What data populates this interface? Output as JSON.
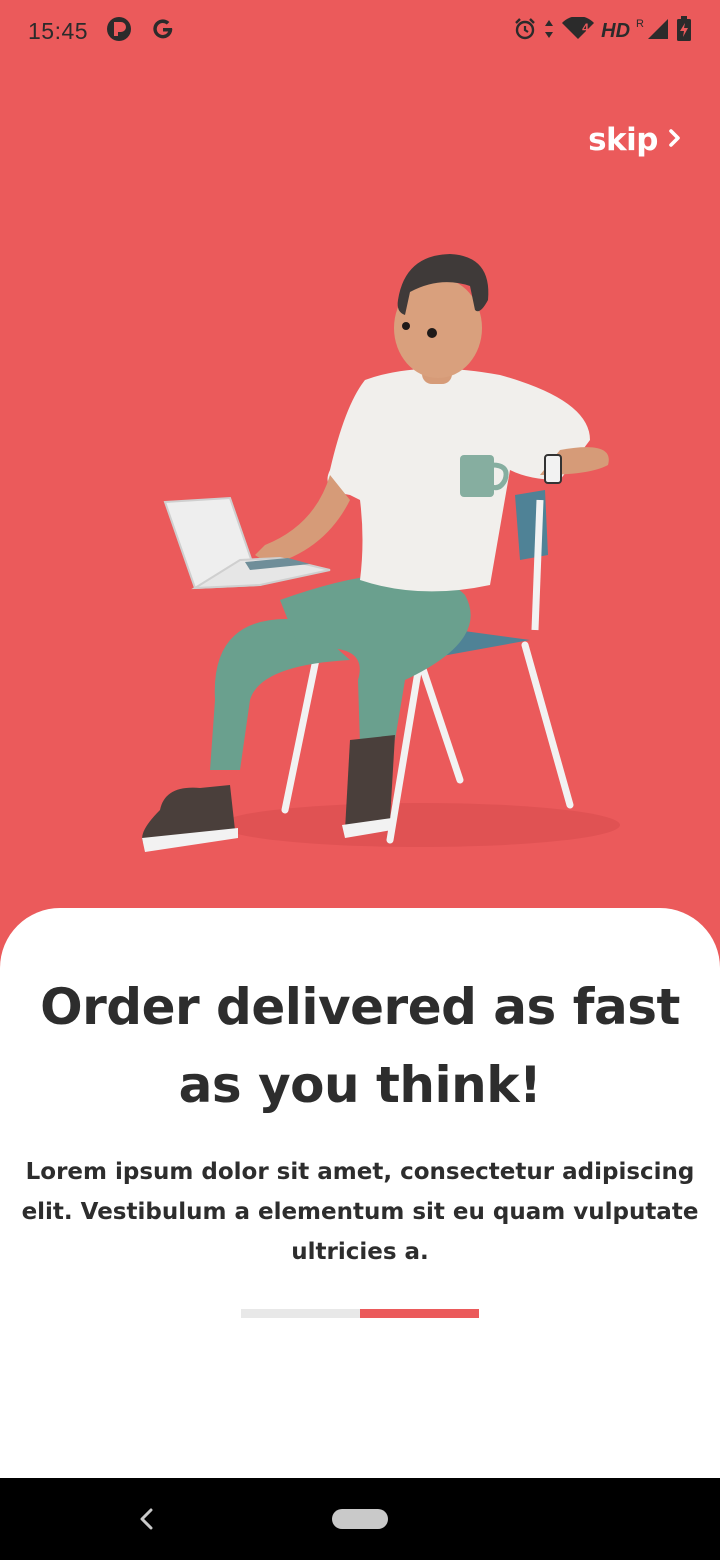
{
  "status_bar": {
    "time": "15:45",
    "network_label": "HD",
    "roaming_label": "R",
    "signal_badge": "4",
    "icons": [
      "app-notification-icon",
      "google-icon",
      "alarm-icon",
      "data-arrows-icon",
      "wifi-icon",
      "signal-icon",
      "battery-charging-icon"
    ]
  },
  "skip": {
    "label": "skip"
  },
  "colors": {
    "accent": "#eb5a5b",
    "text": "#2d2d2d",
    "track": "#e8e8e8"
  },
  "onboarding": {
    "illustration": "person-with-laptop-on-chair-illustration",
    "title": "Order delivered as fast as you think!",
    "body": "Lorem ipsum dolor sit amet, consectetur adipiscing elit. Vestibulum a elementum sit eu quam vulputate ultricies a.",
    "page_indicator": {
      "current_page": 2,
      "total_pages": 2
    }
  },
  "nav_bar": {
    "icons": [
      "back-icon",
      "home-pill-icon"
    ]
  }
}
